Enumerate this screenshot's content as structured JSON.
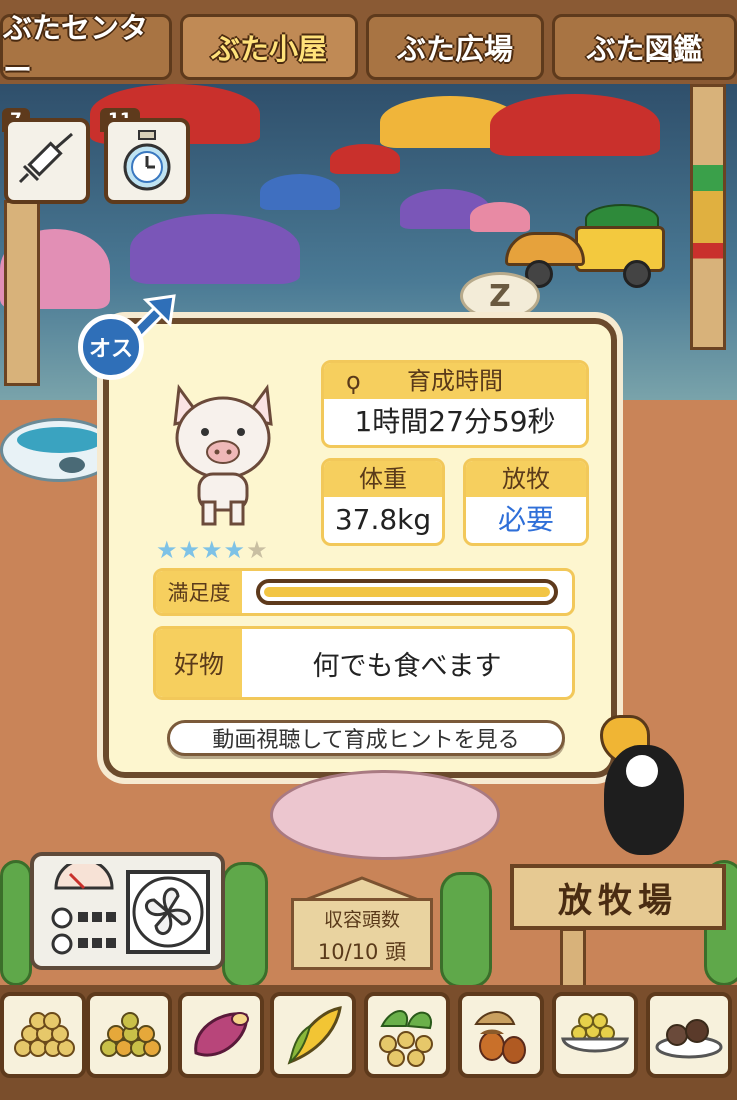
{
  "tabs": [
    {
      "label": "ぶたセンター",
      "active": false
    },
    {
      "label": "ぶた小屋",
      "active": true
    },
    {
      "label": "ぶた広場",
      "active": false
    },
    {
      "label": "ぶた図鑑",
      "active": false
    }
  ],
  "items": [
    {
      "count": "7",
      "icon": "syringe-icon"
    },
    {
      "count": "11",
      "icon": "stopwatch-icon"
    }
  ],
  "sleep_mark": "Z",
  "pig": {
    "gender_label": "オス",
    "stars_filled": 4,
    "stars_total": 5,
    "growth_time_label": "育成時間",
    "growth_time_value": "1時間27分59秒",
    "weight_label": "体重",
    "weight_value": "37.8kg",
    "grazing_label": "放牧",
    "grazing_value": "必要",
    "satisfaction_label": "満足度",
    "satisfaction_fraction": 1.0,
    "favorite_label": "好物",
    "favorite_value": "何でも食べます",
    "hint_button_label": "動画視聴して育成ヒントを見る"
  },
  "capacity": {
    "label": "収容頭数",
    "value": "10/10 頭"
  },
  "pasture_sign": "放牧場",
  "feeds": [
    "soybean-feed-icon",
    "mixed-grain-icon",
    "sweet-potato-icon",
    "corn-icon",
    "nuts-leaf-icon",
    "acorn-icon",
    "grain-bowl-icon",
    "truffle-plate-icon"
  ],
  "colors": {
    "accent_yellow": "#f6cf5e",
    "gender_blue": "#2f6fb8",
    "grazing_text": "#2f6fd8",
    "star_on": "#7ec2e6",
    "bar_fill": "#f2c544"
  }
}
